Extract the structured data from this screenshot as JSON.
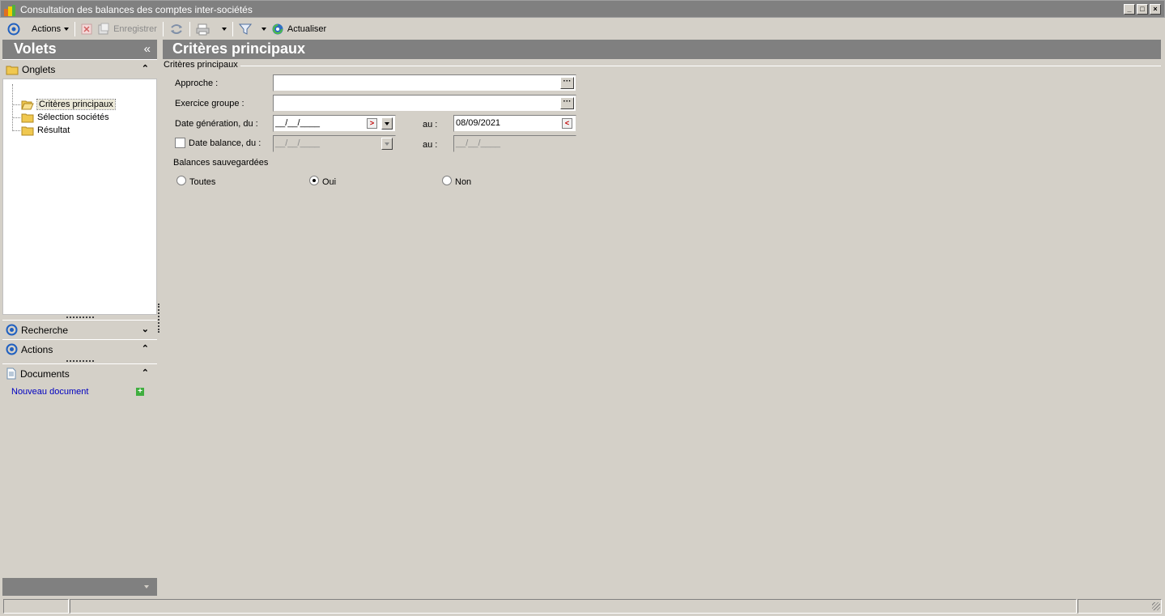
{
  "window": {
    "title": "Consultation des balances des comptes inter-sociétés",
    "controls": {
      "minimize": "_",
      "maximize": "□",
      "close": "×"
    }
  },
  "toolbar": {
    "actions": "Actions",
    "enregistrer": "Enregistrer",
    "actualiser": "Actualiser"
  },
  "left_panel": {
    "title": "Volets",
    "collapse": "«",
    "onglets": {
      "label": "Onglets",
      "items": [
        {
          "label": "Critères principaux",
          "selected": true
        },
        {
          "label": "Sélection sociétés",
          "selected": false
        },
        {
          "label": "Résultat",
          "selected": false
        }
      ]
    },
    "recherche": "Recherche",
    "actions": "Actions",
    "documents": {
      "label": "Documents",
      "new_doc": "Nouveau document"
    }
  },
  "main": {
    "title": "Critères principaux",
    "group_title": "Critères principaux",
    "approche": {
      "label": "Approche :",
      "value": ""
    },
    "exercice": {
      "label": "Exercice groupe :",
      "value": ""
    },
    "date_gen": {
      "label": "Date génération, du :",
      "from": "__/__/____",
      "to_label": "au :",
      "to": "08/09/2021"
    },
    "date_bal": {
      "label": "Date balance, du :",
      "checked": false,
      "from": "__/__/____",
      "to_label": "au :",
      "to": "__/__/____"
    },
    "balances": {
      "label": "Balances sauvegardées",
      "options": [
        {
          "label": "Toutes",
          "selected": false
        },
        {
          "label": "Oui",
          "selected": true
        },
        {
          "label": "Non",
          "selected": false
        }
      ]
    }
  },
  "colors": {
    "header_gray": "#808080",
    "panel_bg": "#d4d0c8",
    "link_blue": "#0000c0"
  }
}
